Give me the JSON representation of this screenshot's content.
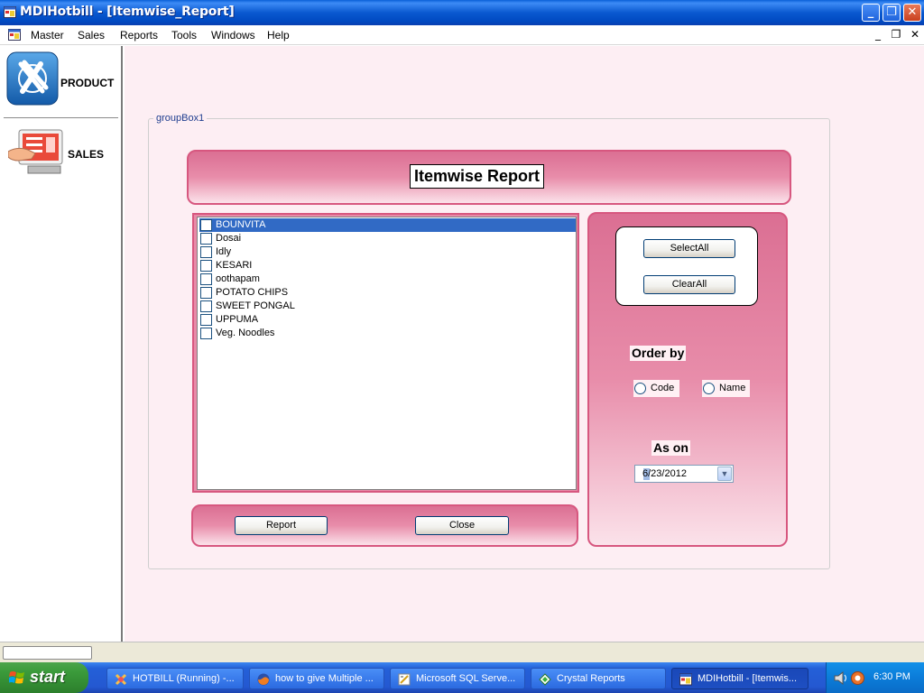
{
  "window": {
    "title": "MDIHotbill - [Itemwise_Report]"
  },
  "menubar": {
    "items": [
      "Master",
      "Sales",
      "Reports",
      "Tools",
      "Windows",
      "Help"
    ],
    "child_controls": [
      "_",
      "❐",
      "✕"
    ]
  },
  "sidebar": {
    "items": [
      {
        "label": "PRODUCT",
        "icon": "product-icon"
      },
      {
        "label": "SALES",
        "icon": "sales-icon"
      }
    ]
  },
  "form": {
    "groupbox_label": "groupBox1",
    "header_title": "Itemwise Report",
    "items": [
      {
        "label": "BOUNVITA",
        "checked": false,
        "selected": true
      },
      {
        "label": "Dosai",
        "checked": false,
        "selected": false
      },
      {
        "label": "Idly",
        "checked": false,
        "selected": false
      },
      {
        "label": "KESARI",
        "checked": false,
        "selected": false
      },
      {
        "label": "oothapam",
        "checked": false,
        "selected": false
      },
      {
        "label": "POTATO CHIPS",
        "checked": false,
        "selected": false
      },
      {
        "label": "SWEET PONGAL",
        "checked": false,
        "selected": false
      },
      {
        "label": "UPPUMA",
        "checked": false,
        "selected": false
      },
      {
        "label": "Veg. Noodles",
        "checked": false,
        "selected": false
      }
    ],
    "select_all_label": "SelectAll",
    "clear_all_label": "ClearAll",
    "order_by_label": "Order by",
    "order_options": [
      {
        "label": "Code",
        "checked": false
      },
      {
        "label": "Name",
        "checked": false
      }
    ],
    "as_on_label": "As on",
    "as_on_date": "6/23/2012",
    "report_label": "Report",
    "close_label": "Close"
  },
  "taskbar": {
    "start_label": "start",
    "items": [
      {
        "label": "HOTBILL (Running) -...",
        "active": false
      },
      {
        "label": "how to give Multiple ...",
        "active": false
      },
      {
        "label": "Microsoft SQL Serve...",
        "active": false
      },
      {
        "label": "Crystal Reports",
        "active": false
      },
      {
        "label": "MDIHotbill - [Itemwis...",
        "active": true
      }
    ],
    "clock": "6:30 PM"
  },
  "colors": {
    "panel_pink": "#e88daa",
    "panel_border": "#d7577f",
    "mdi_background": "#fdeef3",
    "selection_blue": "#316ac5"
  }
}
